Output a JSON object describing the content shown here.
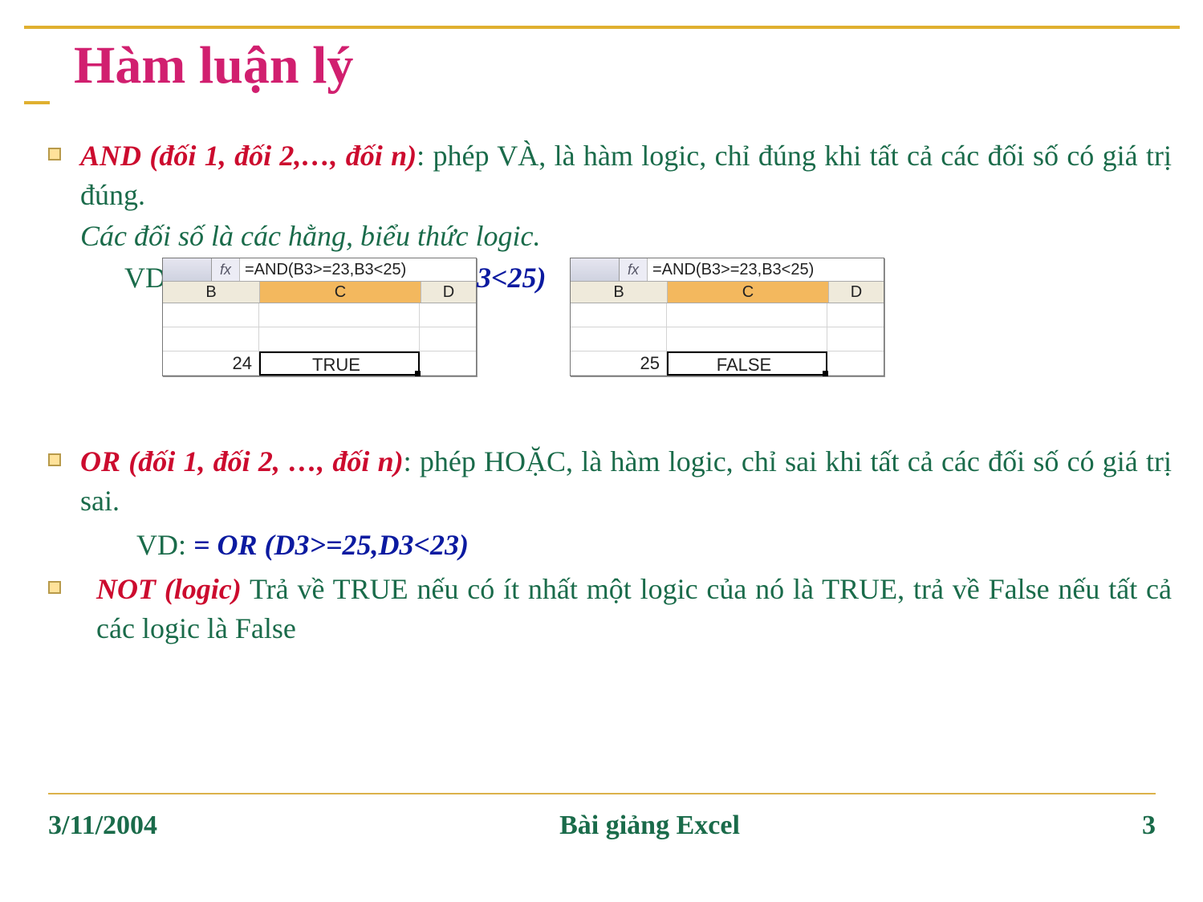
{
  "title": "Hàm luận lý",
  "bullets": {
    "and": {
      "func": "AND (đối 1, đối 2,…, đối n)",
      "desc": ": phép VÀ, là hàm logic, chỉ đúng khi tất cả các đối số có giá trị đúng.",
      "note": "Các đối số là các hằng, biểu thức logic.",
      "vd_label": "VD",
      "vd_formula_suffix": "3<25)"
    },
    "or": {
      "func": "OR (đối 1, đối 2, …, đối n)",
      "desc": ": phép HOẶC, là hàm logic, chỉ sai khi tất cả các đối số có giá trị sai.",
      "vd_label": "VD: ",
      "vd_formula": "= OR (D3>=25,D3<23)"
    },
    "not": {
      "func": "NOT (logic)",
      "desc": " Trả về TRUE nếu có ít nhất một logic của nó là TRUE, trả về False nếu tất cả các logic là False"
    }
  },
  "excel": {
    "formula": "=AND(B3>=23,B3<25)",
    "fx": "fx",
    "cols": {
      "b": "B",
      "c": "C",
      "d": "D"
    },
    "snip1": {
      "b3": "24",
      "c3": "TRUE"
    },
    "snip2": {
      "b3": "25",
      "c3": "FALSE"
    }
  },
  "footer": {
    "date": "3/11/2004",
    "center": "Bài giảng Excel",
    "page": "3"
  }
}
